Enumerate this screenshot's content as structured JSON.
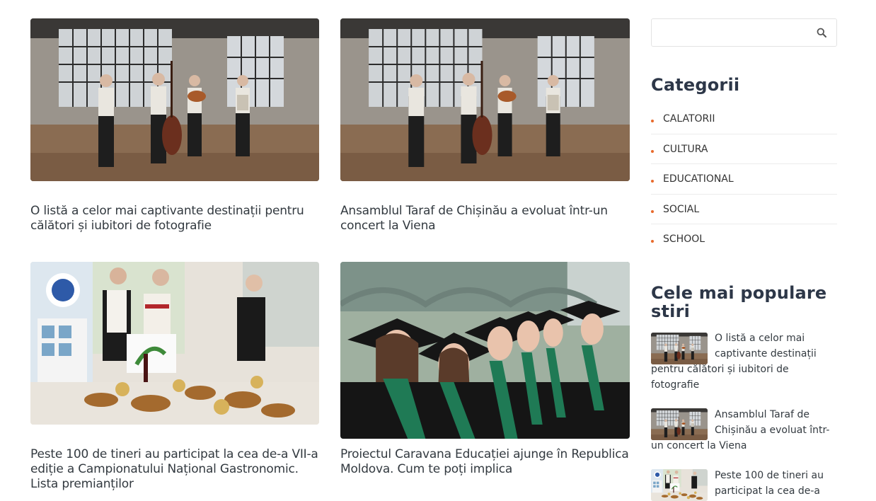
{
  "posts": [
    {
      "title": "O listă a celor mai captivante destinații pentru călători și iubitori de fotografie",
      "image": "folk-band-concert-photo"
    },
    {
      "title": "Ansamblul Taraf de Chișinău a evoluat într-un concert la Viena",
      "image": "folk-band-concert-photo"
    },
    {
      "title": "Peste 100 de tineri au participat la cea de-a VII-a ediție a Campionatului Național Gastronomic. Lista premianților",
      "image": "gastronomy-exhibition-photo"
    },
    {
      "title": "Proiectul Caravana Educației ajunge în Republica Moldova. Cum te poți implica",
      "image": "graduates-photo"
    }
  ],
  "sidebar": {
    "search": {
      "placeholder": "",
      "icon": "search-icon"
    },
    "categories_title": "Categorii",
    "categories": [
      "CALATORII",
      "CULTURA",
      "EDUCATIONAL",
      "SOCIAL",
      "SCHOOL"
    ],
    "popular_title": "Cele mai populare stiri",
    "popular": [
      {
        "title": "O listă a celor mai captivante destinații pentru călători și iubitori de fotografie"
      },
      {
        "title": "Ansamblul Taraf de Chișinău a evoluat într-un concert la Viena"
      },
      {
        "title": "Peste 100 de tineri au participat la cea de-a"
      }
    ]
  },
  "colors": {
    "accent": "#e86a2c",
    "title": "#333a40",
    "heading": "#2d3748"
  }
}
